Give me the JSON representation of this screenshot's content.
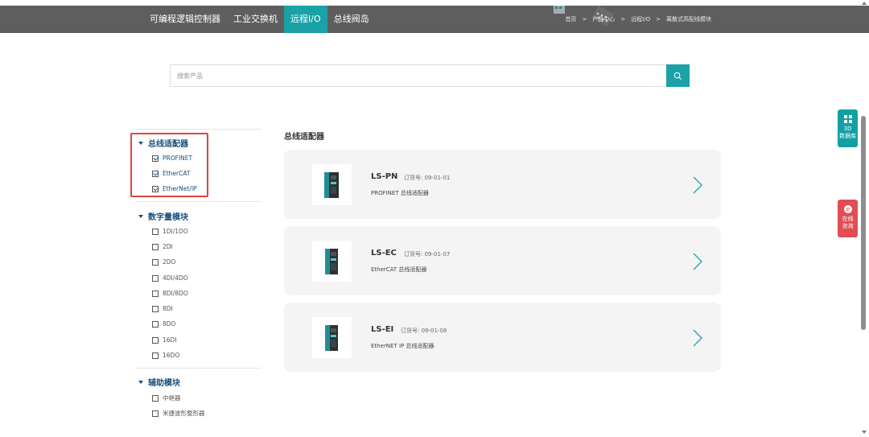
{
  "nav": {
    "items": [
      {
        "label": "可编程逻辑控制器",
        "active": false
      },
      {
        "label": "工业交换机",
        "active": false
      },
      {
        "label": "远程I/O",
        "active": true
      },
      {
        "label": "总线阀岛",
        "active": false
      }
    ],
    "breadcrumb": [
      "首页",
      "产品中心",
      "远程I/O",
      "离散式高配线模块"
    ],
    "breadcrumb_sep": ">"
  },
  "search": {
    "placeholder": "搜索产品",
    "button_icon": "search-icon"
  },
  "sidebar": {
    "groups": [
      {
        "title": "总线适配器",
        "options": [
          {
            "label": "PROFINET",
            "checked": true
          },
          {
            "label": "EtherCAT",
            "checked": true
          },
          {
            "label": "EtherNet/IP",
            "checked": true
          }
        ]
      },
      {
        "title": "数字量模块",
        "options": [
          {
            "label": "1DI/1DO",
            "checked": false
          },
          {
            "label": "2DI",
            "checked": false
          },
          {
            "label": "2DO",
            "checked": false
          },
          {
            "label": "4DI/4DO",
            "checked": false
          },
          {
            "label": "8DI/8DO",
            "checked": false
          },
          {
            "label": "8DI",
            "checked": false
          },
          {
            "label": "8DO",
            "checked": false
          },
          {
            "label": "16DI",
            "checked": false
          },
          {
            "label": "16DO",
            "checked": false
          }
        ]
      },
      {
        "title": "辅助模块",
        "options": [
          {
            "label": "中继器",
            "checked": false
          },
          {
            "label": "米捷波形整形器",
            "checked": false
          }
        ]
      }
    ]
  },
  "main": {
    "section_title": "总线适配器",
    "order_label": "订货号:",
    "products": [
      {
        "model": "LS-PN",
        "order_no": "09-01-01",
        "desc": "PROFINET 总线适配器"
      },
      {
        "model": "LS-EC",
        "order_no": "09-01-07",
        "desc": "EtherCAT 总线适配器"
      },
      {
        "model": "LS-EI",
        "order_no": "09-01-08",
        "desc": "EtherNET IP 总线适配器"
      }
    ]
  },
  "floating": {
    "db": {
      "line1": "3D",
      "line2": "数据库",
      "icon": "grid-icon"
    },
    "chat": {
      "line1": "在线",
      "line2": "咨询",
      "icon": "chat-icon"
    }
  },
  "colors": {
    "nav_bg": "#5e5e5e",
    "accent": "#1aa2a6",
    "group_title": "#1a4f7a",
    "highlight": "#e0443b",
    "chat_bg": "#e24d53"
  }
}
